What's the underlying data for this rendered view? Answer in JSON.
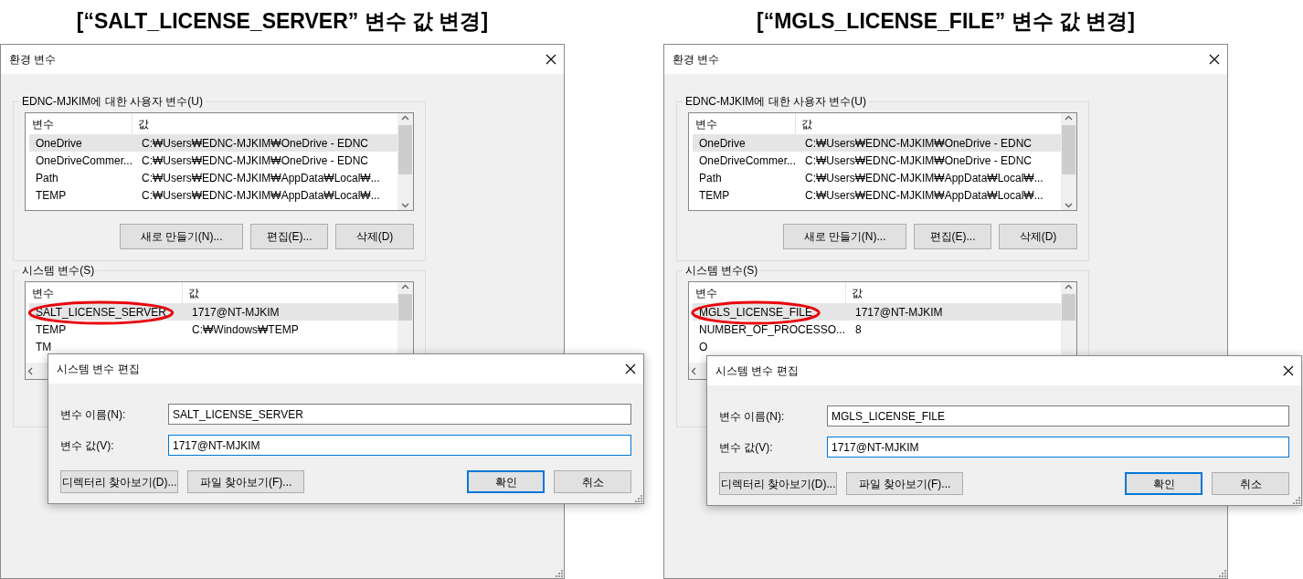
{
  "panels": [
    {
      "heading": "[“SALT_LICENSE_SERVER” 변수 값 변경]",
      "window": {
        "title": "환경 변수"
      },
      "user_variables": {
        "label": "EDNC-MJKIM에 대한 사용자 변수(U)",
        "columns": [
          "변수",
          "값"
        ],
        "rows": [
          {
            "name": "OneDrive",
            "value": "C:₩Users₩EDNC-MJKIM₩OneDrive - EDNC",
            "selected": true
          },
          {
            "name": "OneDriveCommer...",
            "value": "C:₩Users₩EDNC-MJKIM₩OneDrive - EDNC",
            "selected": false
          },
          {
            "name": "Path",
            "value": "C:₩Users₩EDNC-MJKIM₩AppData₩Local₩...",
            "selected": false
          },
          {
            "name": "TEMP",
            "value": "C:₩Users₩EDNC-MJKIM₩AppData₩Local₩...",
            "selected": false
          }
        ],
        "buttons": [
          "새로 만들기(N)...",
          "편집(E)...",
          "삭제(D)"
        ]
      },
      "system_variables": {
        "label": "시스템 변수(S)",
        "columns": [
          "변수",
          "값"
        ],
        "rows": [
          {
            "name": "SALT_LICENSE_SERVER",
            "value": "1717@NT-MJKIM",
            "selected": true,
            "circled": true
          },
          {
            "name": "TEMP",
            "value": "C:₩Windows₩TEMP",
            "selected": false,
            "circled": false
          },
          {
            "name": "TM",
            "selected": false,
            "circled": false
          }
        ]
      },
      "edit_dialog": {
        "title": "시스템 변수 편집",
        "fields": [
          {
            "label": "변수 이름(N):",
            "value": "SALT_LICENSE_SERVER",
            "focused": false
          },
          {
            "label": "변수 값(V):",
            "value": "1717@NT-MJKIM",
            "focused": true
          }
        ],
        "buttons": [
          {
            "label": "디렉터리 찾아보기(D)...",
            "default": false
          },
          {
            "label": "파일 찾아보기(F)...",
            "default": false
          },
          {
            "label": "확인",
            "default": true
          },
          {
            "label": "취소",
            "default": false
          }
        ]
      }
    },
    {
      "heading": "[“MGLS_LICENSE_FILE” 변수 값 변경]",
      "window": {
        "title": "환경 변수"
      },
      "user_variables": {
        "label": "EDNC-MJKIM에 대한 사용자 변수(U)",
        "columns": [
          "변수",
          "값"
        ],
        "rows": [
          {
            "name": "OneDrive",
            "value": "C:₩Users₩EDNC-MJKIM₩OneDrive - EDNC",
            "selected": true
          },
          {
            "name": "OneDriveCommer...",
            "value": "C:₩Users₩EDNC-MJKIM₩OneDrive - EDNC",
            "selected": false
          },
          {
            "name": "Path",
            "value": "C:₩Users₩EDNC-MJKIM₩AppData₩Local₩...",
            "selected": false
          },
          {
            "name": "TEMP",
            "value": "C:₩Users₩EDNC-MJKIM₩AppData₩Local₩...",
            "selected": false
          }
        ],
        "buttons": [
          "새로 만들기(N)...",
          "편집(E)...",
          "삭제(D)"
        ]
      },
      "system_variables": {
        "label": "시스템 변수(S)",
        "columns": [
          "변수",
          "값"
        ],
        "rows": [
          {
            "name": "MGLS_LICENSE_FILE",
            "value": "1717@NT-MJKIM",
            "selected": true,
            "circled": true
          },
          {
            "name": "NUMBER_OF_PROCESSO...",
            "value": "8",
            "selected": false,
            "circled": false
          },
          {
            "name": "O",
            "selected": false,
            "circled": false
          }
        ]
      },
      "edit_dialog": {
        "title": "시스템 변수 편집",
        "fields": [
          {
            "label": "변수 이름(N):",
            "value": "MGLS_LICENSE_FILE",
            "focused": false
          },
          {
            "label": "변수 값(V):",
            "value": "1717@NT-MJKIM",
            "focused": true
          }
        ],
        "buttons": [
          {
            "label": "디렉터리 찾아보기(D)...",
            "default": false
          },
          {
            "label": "파일 찾아보기(F)...",
            "default": false
          },
          {
            "label": "확인",
            "default": true
          },
          {
            "label": "취소",
            "default": false
          }
        ]
      }
    }
  ]
}
